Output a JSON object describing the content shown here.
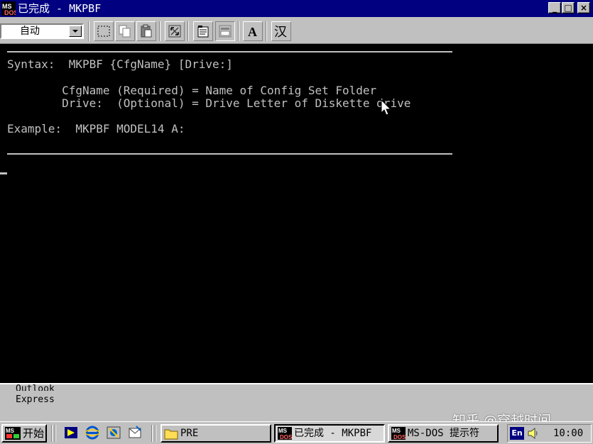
{
  "window": {
    "title": "已完成 - MKPBF",
    "buttons": {
      "minimize": "_",
      "maximize": "□",
      "close": "×"
    }
  },
  "toolbar": {
    "font_size_select": "自动",
    "buttons": [
      {
        "name": "mark-icon"
      },
      {
        "name": "copy-icon"
      },
      {
        "name": "paste-icon"
      },
      {
        "name": "fullscreen-icon"
      },
      {
        "name": "properties-icon"
      },
      {
        "name": "background-icon"
      },
      {
        "name": "font-icon",
        "glyph": "A"
      },
      {
        "name": "chinese-input-icon",
        "glyph": "汉"
      }
    ]
  },
  "console": {
    "lines": [
      "Syntax:  MKPBF {CfgName} [Drive:]",
      "        CfgName (Required) = Name of Config Set Folder",
      "        Drive:  (Optional) = Drive Letter of Diskette drive",
      "Example:  MKPBF MODEL14 A:"
    ]
  },
  "desktop": {
    "icon_label_line1": "Outlook",
    "icon_label_line2": "Express"
  },
  "watermark": "知乎 @穿越时间",
  "taskbar": {
    "start_label": "开始",
    "quick_launch": [
      "show-desktop-icon",
      "internet-explorer-icon",
      "channels-icon",
      "outlook-express-icon"
    ],
    "tasks": [
      {
        "label": "PRE",
        "icon": "folder-icon"
      },
      {
        "label": "已完成 - MKPBF",
        "icon": "msdos-icon",
        "active": "true"
      },
      {
        "label": "MS-DOS 提示符",
        "icon": "msdos-icon"
      }
    ],
    "tray": {
      "language": "En",
      "clock": "10:00"
    }
  },
  "colors": {
    "titlebar": "#000080",
    "chrome": "#c0c0c0",
    "console_bg": "#000000",
    "console_fg": "#c0c0c0"
  }
}
